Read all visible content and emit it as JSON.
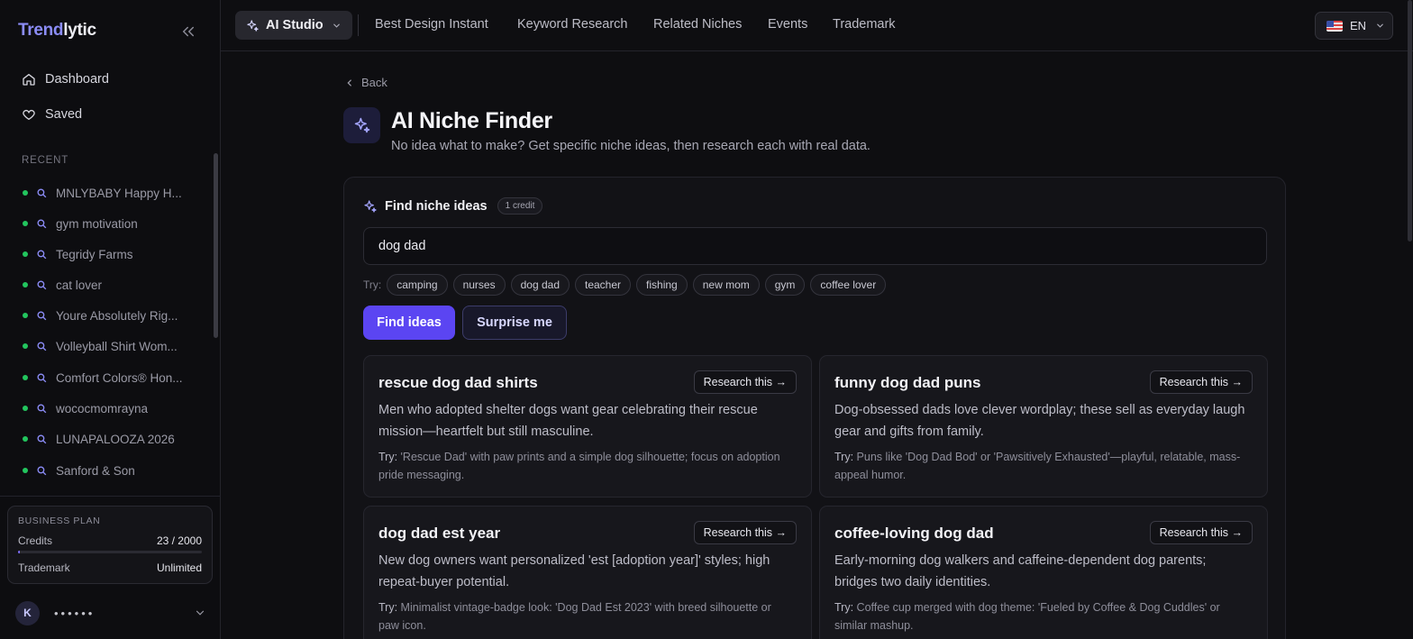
{
  "app": {
    "logo_a": "Trend",
    "logo_b": "lytic"
  },
  "sidebar": {
    "nav": [
      {
        "label": "Dashboard",
        "icon": "home-icon"
      },
      {
        "label": "Saved",
        "icon": "heart-icon"
      }
    ],
    "recent_label": "RECENT",
    "recent": [
      "MNLYBABY Happy H...",
      "gym motivation",
      "Tegridy Farms",
      "cat lover",
      "Youre Absolutely Rig...",
      "Volleyball Shirt Wom...",
      "Comfort Colors® Hon...",
      "wococmomrayna",
      "LUNAPALOOZA 2026",
      "Sanford & Son"
    ],
    "plan": {
      "title": "BUSINESS PLAN",
      "credits_label": "Credits",
      "credits_value": "23 / 2000",
      "credits_fraction": 0.0115,
      "trademark_label": "Trademark",
      "trademark_value": "Unlimited"
    },
    "user": {
      "initial": "K",
      "name": "••••••"
    }
  },
  "topbar": {
    "studio": "AI Studio",
    "links": [
      "Best Design Instant",
      "Keyword Research",
      "Related Niches",
      "Events",
      "Trademark"
    ],
    "lang": "EN"
  },
  "main": {
    "back": "Back",
    "title": "AI Niche Finder",
    "subtitle": "No idea what to make? Get specific niche ideas, then research each with real data.",
    "find_title": "Find niche ideas",
    "credit_pill": "1 credit",
    "search_value": "dog dad",
    "try_label": "Try:",
    "chips": [
      "camping",
      "nurses",
      "dog dad",
      "teacher",
      "fishing",
      "new mom",
      "gym",
      "coffee lover"
    ],
    "find_button": "Find ideas",
    "surprise_button": "Surprise me",
    "research_label": "Research this →",
    "ideas": [
      {
        "title": "rescue dog dad shirts",
        "desc": "Men who adopted shelter dogs want gear celebrating their rescue mission—heartfelt but still masculine.",
        "try_prefix": "Try:",
        "try": "'Rescue Dad' with paw prints and a simple dog silhouette; focus on adoption pride messaging."
      },
      {
        "title": "funny dog dad puns",
        "desc": "Dog-obsessed dads love clever wordplay; these sell as everyday laugh gear and gifts from family.",
        "try_prefix": "Try:",
        "try": "Puns like 'Dog Dad Bod' or 'Pawsitively Exhausted'—playful, relatable, mass-appeal humor."
      },
      {
        "title": "dog dad est year",
        "desc": "New dog owners want personalized 'est [adoption year]' styles; high repeat-buyer potential.",
        "try_prefix": "Try:",
        "try": "Minimalist vintage-badge look: 'Dog Dad Est 2023' with breed silhouette or paw icon."
      },
      {
        "title": "coffee-loving dog dad",
        "desc": "Early-morning dog walkers and caffeine-dependent dog parents; bridges two daily identities.",
        "try_prefix": "Try:",
        "try": "Coffee cup merged with dog theme: 'Fueled by Coffee & Dog Cuddles' or similar mashup."
      }
    ]
  },
  "colors": {
    "accent": "#5b45f2",
    "accent_light": "#8b8cf6",
    "status_dot": "#22c55e",
    "bg": "#0e0e11"
  }
}
